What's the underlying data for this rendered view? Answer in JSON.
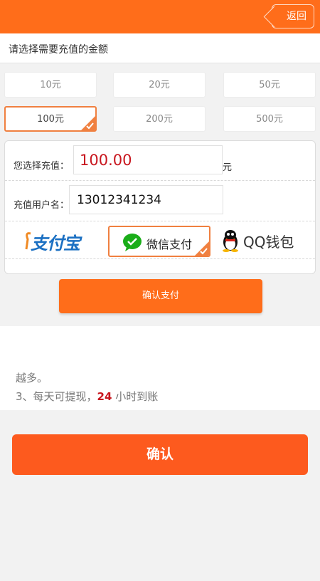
{
  "header": {
    "back_label": "返回"
  },
  "section": {
    "title": "请选择需要充值的金额"
  },
  "amounts": [
    {
      "label": "10元",
      "selected": false
    },
    {
      "label": "20元",
      "selected": false
    },
    {
      "label": "50元",
      "selected": false
    },
    {
      "label": "100元",
      "selected": true
    },
    {
      "label": "200元",
      "selected": false
    },
    {
      "label": "500元",
      "selected": false
    }
  ],
  "form": {
    "amount_label": "您选择充值：",
    "amount_value": "100.00",
    "amount_unit": "元",
    "user_label": "充值用户名：",
    "user_value": "13012341234"
  },
  "payment": {
    "alipay": "支付宝",
    "wechat": "微信支付",
    "qq": "QQ钱包",
    "selected": "wechat"
  },
  "confirm_pay_label": "确认支付",
  "info": {
    "line1_cut": "越多。",
    "line2_prefix": "3、每天可提现，",
    "line2_number": "24",
    "line2_suffix": " 小时到账"
  },
  "confirm_label": "确认",
  "colors": {
    "accent": "#ff6d1a",
    "confirm": "#fd5a1e",
    "highlight_red": "#c8161e",
    "wechat_green": "#1aad19",
    "alipay_blue": "#1a6fc2"
  }
}
